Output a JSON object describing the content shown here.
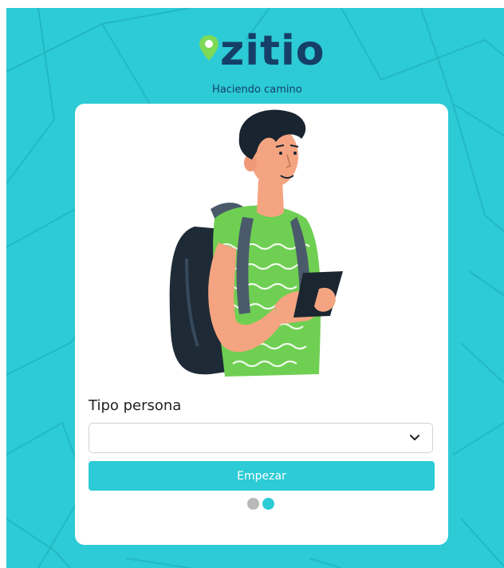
{
  "brand": {
    "name": "zitio",
    "tagline": "Haciendo camino",
    "accent_color": "#2ccbd6",
    "text_color": "#153f66",
    "pin_color": "#7ed957"
  },
  "form": {
    "field_label": "Tipo persona",
    "select_value": "",
    "submit_label": "Empezar"
  },
  "pagination": {
    "total": 2,
    "active_index": 1,
    "inactive_color": "#b8b8b8",
    "active_color": "#2ccbd6"
  },
  "illustration": {
    "subject": "man-with-backpack-holding-phone-illustration"
  }
}
